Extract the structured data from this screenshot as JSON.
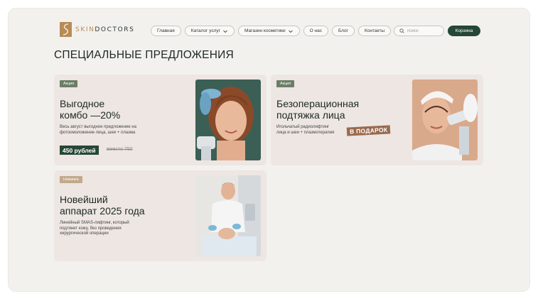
{
  "header": {
    "logo_text_a": "SKIN",
    "logo_text_b": "DOCTORS",
    "nav": [
      {
        "label": "Главная",
        "dropdown": false
      },
      {
        "label": "Каталог услуг",
        "dropdown": true
      },
      {
        "label": "Магазин косметики",
        "dropdown": true
      },
      {
        "label": "О нас",
        "dropdown": false
      },
      {
        "label": "Блог",
        "dropdown": false
      },
      {
        "label": "Контакты",
        "dropdown": false
      }
    ],
    "search_placeholder": "поиск",
    "cart_label": "Корзина"
  },
  "page": {
    "title": "СПЕЦИАЛЬНЫЕ ПРЕДЛОЖЕНИЯ"
  },
  "offers": [
    {
      "badge": "Акция",
      "title_line1": "Выгодное",
      "title_line2": "комбо —20%",
      "desc_line1": "Весь август выгодное предложение на",
      "desc_line2": "фотоомоложение лица, шеи + плазма",
      "price": "450 рублей",
      "old_price": "вместо 750"
    },
    {
      "badge": "Акция",
      "title_line1": "Безоперационная",
      "title_line2": "подтяжка лица",
      "desc_line1": "Игольчатый радиолифтинг",
      "desc_line2": "лица и шеи + плазмотерапия",
      "gift": "В ПОДАРОК"
    },
    {
      "badge": "Новинка",
      "title_line1": "Новейший",
      "title_line2": "аппарат 2025 года",
      "desc_line1": "Линейный SMAS-лифтинг, который",
      "desc_line2": "подтянет кожу, без проведения",
      "desc_line3": "хирургической операции"
    }
  ],
  "colors": {
    "brand_green": "#264736",
    "brand_gold": "#b78b56",
    "badge_green": "#6b7f66",
    "badge_tan": "#c2a98c",
    "gift_brown": "#9a6a4d"
  }
}
